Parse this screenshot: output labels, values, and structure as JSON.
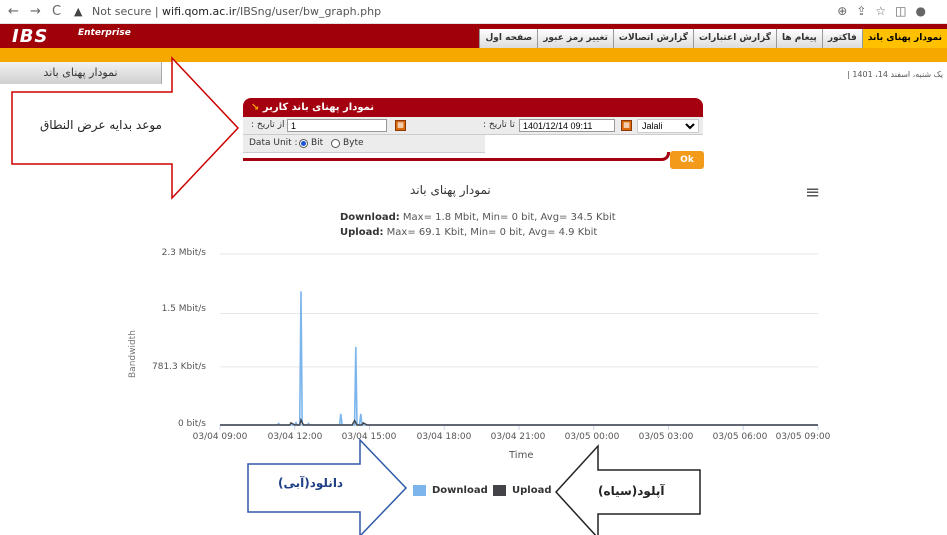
{
  "browser": {
    "warning": "Not secure",
    "url_host": "wifi.qom.ac.ir",
    "url_path": "/IBSng/user/bw_graph.php"
  },
  "app": {
    "logo": "IBS",
    "edition": "Enterprise",
    "menu": [
      "نمودار پهنای باند",
      "فاکتور",
      "پیغام ها",
      "گزارش اعتبارات",
      "گزارش اتصالات",
      "تغییر رمز عبور",
      "صفحه اول"
    ],
    "page_tab": "نمودار پهنای باند",
    "date_text": "یک شنبه، اسفند 14، 1401 |"
  },
  "form": {
    "title": "نمودار پهنای باند کاربر",
    "from_label": ": از تاریخ",
    "from_value": "1",
    "to_label": ": تا تاریخ",
    "to_value": "1401/12/14 09:11",
    "calendar": "Jalali",
    "unit_label": "Data Unit :",
    "unit_bit": "Bit",
    "unit_byte": "Byte",
    "ok": "Ok"
  },
  "chart_data": {
    "type": "line",
    "title": "نمودار پهنای باند",
    "subtitle_download_label": "Download:",
    "subtitle_download": "Max= 1.8 Mbit, Min= 0 bit, Avg= 34.5 Kbit",
    "subtitle_upload_label": "Upload:",
    "subtitle_upload": "Max= 69.1 Kbit, Min= 0 bit, Avg= 4.9 Kbit",
    "ylabel": "Bandwidth",
    "xlabel": "Time",
    "y_ticks": [
      "0 bit/s",
      "781.3 Kbit/s",
      "1.5 Mbit/s",
      "2.3 Mbit/s"
    ],
    "ylim": [
      0,
      2.3
    ],
    "x_ticks": [
      "03/04 09:00",
      "03/04 12:00",
      "03/04 15:00",
      "03/04 18:00",
      "03/04 21:00",
      "03/05 00:00",
      "03/05 03:00",
      "03/05 06:00",
      "03/05 09:00"
    ],
    "xlim_hours": [
      0,
      24
    ],
    "grid": true,
    "legend_position": "bottom-center",
    "series": [
      {
        "name": "Download",
        "color": "#7cb5ec",
        "points": [
          [
            0,
            0
          ],
          [
            2.3,
            0
          ],
          [
            2.35,
            0.02
          ],
          [
            2.4,
            0
          ],
          [
            3.0,
            0
          ],
          [
            3.05,
            0.03
          ],
          [
            3.1,
            0
          ],
          [
            3.2,
            0
          ],
          [
            3.25,
            1.8
          ],
          [
            3.3,
            0
          ],
          [
            3.5,
            0
          ],
          [
            3.55,
            0.02
          ],
          [
            3.6,
            0
          ],
          [
            4.8,
            0
          ],
          [
            4.85,
            0.15
          ],
          [
            4.9,
            0
          ],
          [
            5.4,
            0
          ],
          [
            5.45,
            1.05
          ],
          [
            5.5,
            0
          ],
          [
            5.6,
            0
          ],
          [
            5.65,
            0.15
          ],
          [
            5.7,
            0
          ],
          [
            6.0,
            0
          ],
          [
            24,
            0
          ]
        ]
      },
      {
        "name": "Upload",
        "color": "#434348",
        "points": [
          [
            0,
            0
          ],
          [
            2.8,
            0
          ],
          [
            2.85,
            0.03
          ],
          [
            3.0,
            0
          ],
          [
            3.2,
            0
          ],
          [
            3.25,
            0.069
          ],
          [
            3.35,
            0
          ],
          [
            5.3,
            0
          ],
          [
            5.4,
            0.06
          ],
          [
            5.5,
            0
          ],
          [
            5.7,
            0
          ],
          [
            5.75,
            0.03
          ],
          [
            5.9,
            0
          ],
          [
            24,
            0
          ]
        ]
      }
    ]
  },
  "annotations": {
    "range_start": "موعد بدايه عرض النطاق",
    "download_blue": "دانلود(آبی)",
    "upload_black": "آپلود(سیاه)"
  }
}
